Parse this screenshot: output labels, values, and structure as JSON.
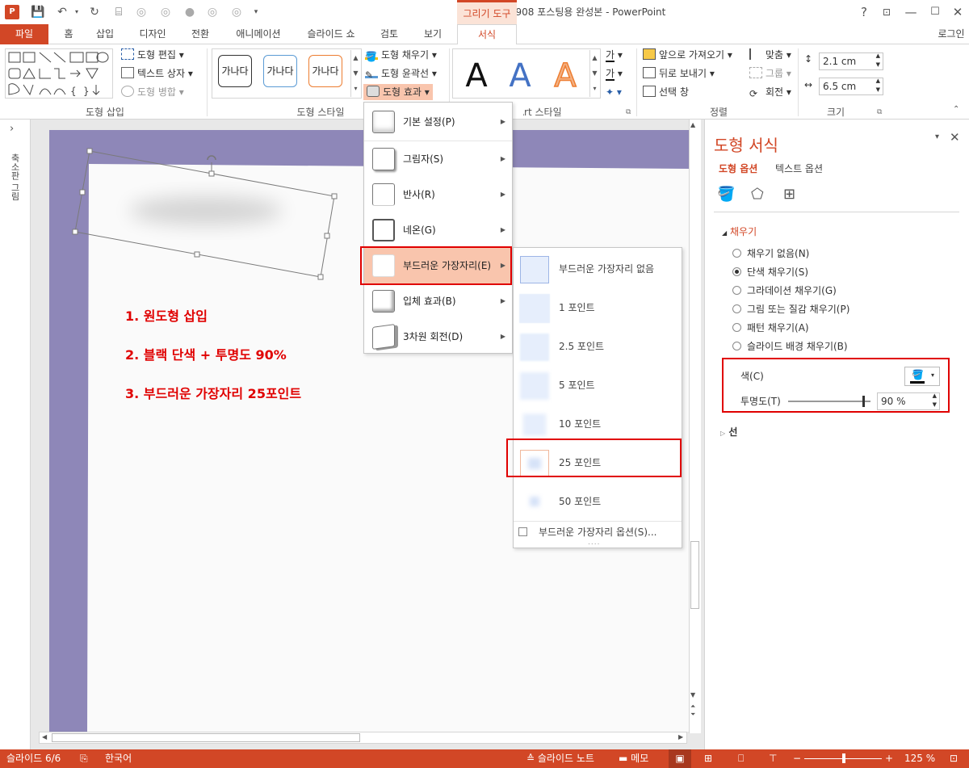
{
  "window": {
    "title": "201908 포스팅용 완성본 - PowerPoint",
    "context_tab_group": "그리기 도구",
    "help": "?",
    "login": "로그인"
  },
  "tabs": [
    "파일",
    "홈",
    "삽입",
    "디자인",
    "전환",
    "애니메이션",
    "슬라이드 쇼",
    "검토",
    "보기",
    "서식"
  ],
  "ribbon": {
    "insert_shapes": {
      "edit_shape": "도형 편집",
      "text_box": "텍스트 상자",
      "merge_shapes": "도형 병합",
      "label": "도형 삽입"
    },
    "shape_styles": {
      "swatch_text": "가나다",
      "fill": "도형 채우기",
      "outline": "도형 윤곽선",
      "effects": "도형 효과",
      "label": "도형 스타일"
    },
    "wordart": {
      "letter": "A",
      "label": "WordArt 스타일",
      "text_fill_glyph": "가"
    },
    "arrange": {
      "bring_forward": "앞으로 가져오기",
      "send_backward": "뒤로 보내기",
      "selection_pane": "선택 창",
      "align": "맞춤",
      "group": "그룹",
      "rotate": "회전",
      "label": "정렬"
    },
    "size": {
      "height": "2.1 cm",
      "width": "6.5 cm",
      "label": "크기"
    }
  },
  "left_pane": {
    "label": "축소판 그림"
  },
  "slide": {
    "steps": [
      "1. 원도형 삽입",
      "2. 블랙 단색 + 투명도 90%",
      "3. 부드러운 가장자리 25포인트"
    ]
  },
  "effects_menu": {
    "items": [
      {
        "label": "기본 설정(P)"
      },
      {
        "label": "그림자(S)"
      },
      {
        "label": "반사(R)"
      },
      {
        "label": "네온(G)"
      },
      {
        "label": "부드러운 가장자리(E)"
      },
      {
        "label": "입체 효과(B)"
      },
      {
        "label": "3차원 회전(D)"
      }
    ]
  },
  "soft_edges_menu": {
    "items": [
      {
        "label": "부드러운 가장자리 없음"
      },
      {
        "label": "1 포인트"
      },
      {
        "label": "2.5 포인트"
      },
      {
        "label": "5 포인트"
      },
      {
        "label": "10 포인트"
      },
      {
        "label": "25 포인트"
      },
      {
        "label": "50 포인트"
      }
    ],
    "options": "부드러운 가장자리 옵션(S)...",
    "grip": "...."
  },
  "format_panel": {
    "title": "도형 서식",
    "tab_shape": "도형 옵션",
    "tab_text": "텍스트 옵션",
    "fill_section": "채우기",
    "fill_options": [
      {
        "label": "채우기 없음(N)",
        "selected": false
      },
      {
        "label": "단색 채우기(S)",
        "selected": true
      },
      {
        "label": "그라데이션 채우기(G)",
        "selected": false
      },
      {
        "label": "그림 또는 질감 채우기(P)",
        "selected": false
      },
      {
        "label": "패턴 채우기(A)",
        "selected": false
      },
      {
        "label": "슬라이드 배경 채우기(B)",
        "selected": false
      }
    ],
    "color_label": "색(C)",
    "transparency_label": "투명도(T)",
    "transparency_value": "90 %",
    "transparency": 0.9,
    "line_section": "선"
  },
  "status": {
    "slide_index": "슬라이드 6/6",
    "language": "한국어",
    "notes": "슬라이드 노트",
    "comments": "메모",
    "zoom": "125 %"
  },
  "colors": {
    "accent": "#D24726",
    "slide_band": "#8E87B8",
    "step_text": "#E00000",
    "highlight_box": "#E00000"
  }
}
